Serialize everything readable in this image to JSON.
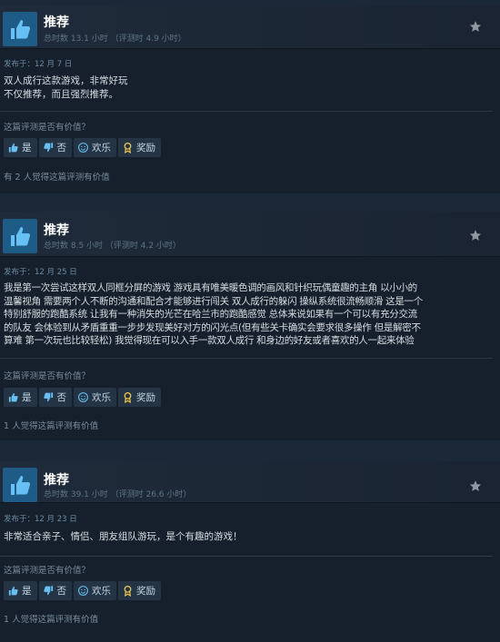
{
  "reviews": [
    {
      "recommend_label": "推荐",
      "playtime": "总时数 13.1 小时 （评测时 4.9 小时）",
      "date": "发布于：12 月 7 日",
      "lines": [
        "双人成行这款游戏，非常好玩",
        "不仅推荐，而且强烈推荐。"
      ],
      "helpful_question": "这篇评测是否有价值？",
      "buttons": {
        "yes": "是",
        "no": "否",
        "funny": "欢乐",
        "award": "奖励"
      },
      "helpful_count": "有 2 人觉得这篇评测有价值"
    },
    {
      "recommend_label": "推荐",
      "playtime": "总时数 8.5 小时 （评测时 4.2 小时）",
      "date": "发布于：12 月 25 日",
      "lines": [
        "我是第一次尝试这样双人同框分屏的游戏 游戏具有唯美暖色调的画风和针织玩偶童趣的主角 以小小的",
        "温馨视角 需要两个人不断的沟通和配合才能够进行闯关 双人成行的躲闪 操纵系统很流畅顺滑 这是一个",
        "特别舒服的跑酷系统 让我有一种消失的光芒在哈兰市的跑酷感觉 总体来说如果有一个可以有充分交流",
        "的队友 会体验到从矛盾重重一步步发现美好对方的闪光点(但有些关卡确实会要求很多操作 但是解密不",
        "算难 第一次玩也比较轻松) 我觉得现在可以入手一款双人成行 和身边的好友或者喜欢的人一起来体验"
      ],
      "helpful_question": "这篇评测是否有价值？",
      "buttons": {
        "yes": "是",
        "no": "否",
        "funny": "欢乐",
        "award": "奖励"
      },
      "helpful_count": "1 人觉得这篇评测有价值"
    },
    {
      "recommend_label": "推荐",
      "playtime": "总时数 39.1 小时 （评测时 26.6 小时）",
      "date": "发布于：12 月 23 日",
      "lines": [
        "非常适合亲子、情侣、朋友组队游玩，是个有趣的游戏！"
      ],
      "helpful_question": "这篇评测是否有价值？",
      "buttons": {
        "yes": "是",
        "no": "否",
        "funny": "欢乐",
        "award": "奖励"
      },
      "helpful_count": "1 人觉得这篇评测有价值"
    }
  ],
  "colors": {
    "page_bg": "#1b2838",
    "card_bg": "#16202d",
    "thumb_bg": "#1e5b86",
    "thumb_icon": "#66c0f4",
    "award_icon": "#f2c94c"
  }
}
